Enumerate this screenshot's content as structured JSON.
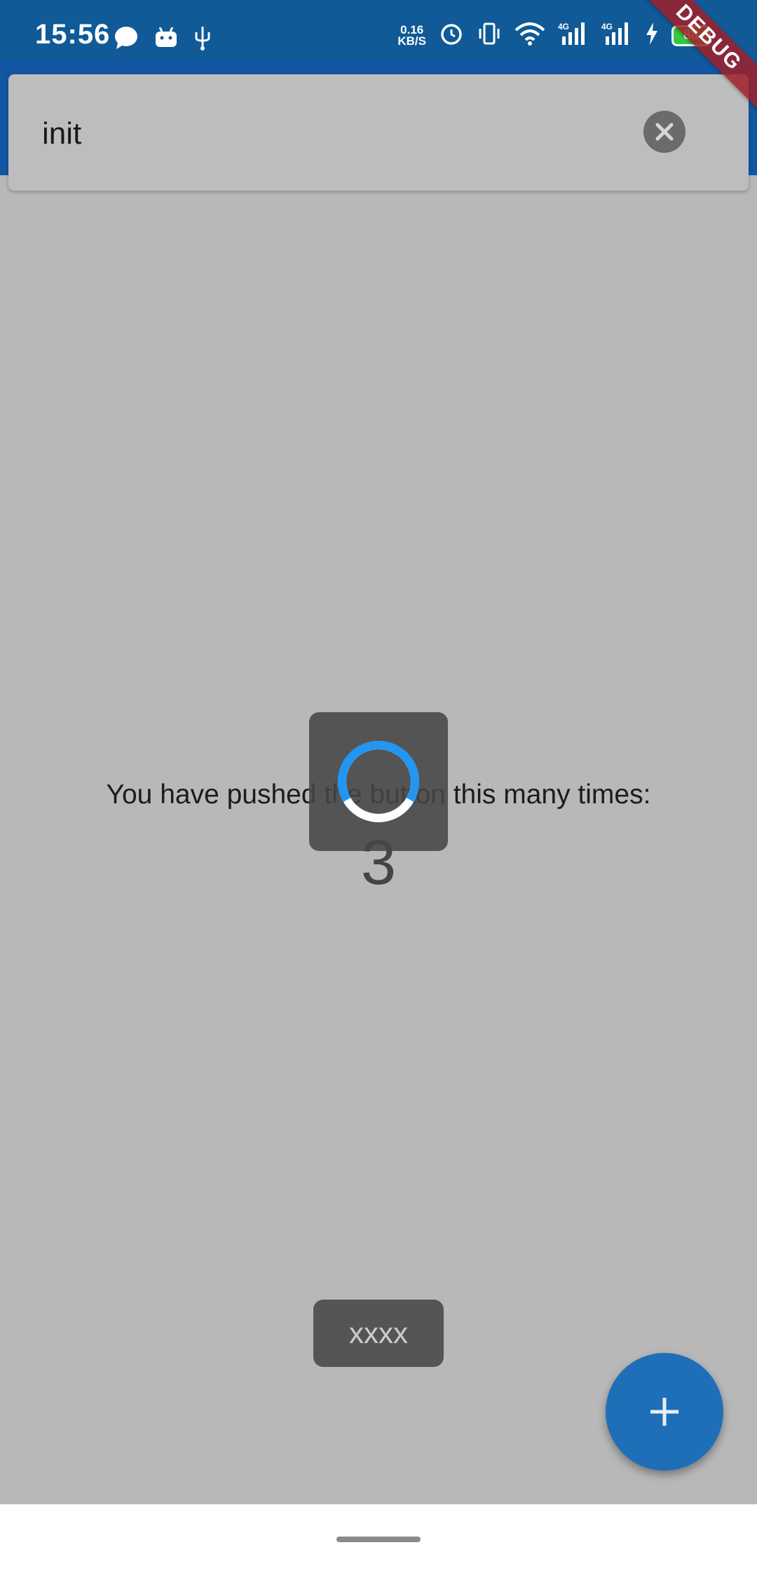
{
  "status_bar": {
    "time": "15:56",
    "network_speed_value": "0.16",
    "network_speed_unit": "KB/S",
    "battery_level": "88",
    "icons": [
      "chat-bubble-icon",
      "android-icon",
      "usb-icon",
      "alarm-icon",
      "vibrate-icon",
      "wifi-icon",
      "signal-4g-icon",
      "signal-4g-icon",
      "charging-icon",
      "battery-icon"
    ]
  },
  "debug_banner": "DEBUG",
  "search": {
    "value": "init",
    "clear_icon": "close-icon"
  },
  "main": {
    "counter_label": "You have pushed the button this many times:",
    "counter_value": "3"
  },
  "loading": {
    "visible": true,
    "spinner_color": "#2196f3"
  },
  "toast": {
    "text": "xxxx"
  },
  "fab": {
    "icon": "plus-icon",
    "color": "#1f6fb8"
  },
  "colors": {
    "status_bar": "#0f5a97",
    "app_bar": "#1565c0",
    "scrim_background": "#b8b8b8"
  }
}
